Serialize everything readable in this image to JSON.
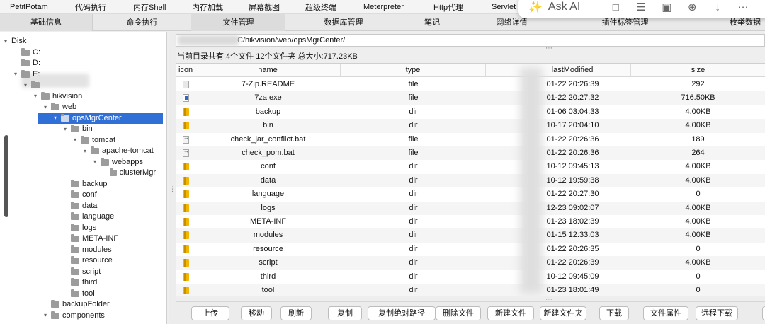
{
  "menu": [
    "PetitPotam",
    "代码执行",
    "内存Shell",
    "内存加载",
    "屏幕截图",
    "超级终端",
    "Meterpreter",
    "Http代理",
    "Servlet"
  ],
  "tabs": [
    "基础信息",
    "命令执行",
    "文件管理",
    "数据库管理",
    "笔记",
    "网络详情",
    "插件标签管理",
    "枚举数据"
  ],
  "active_tab": "文件管理",
  "ask_ai": {
    "label": "Ask AI",
    "icons": [
      "sparkle-icon",
      "chat-icon",
      "list-icon",
      "crop-icon",
      "zoom-in-icon",
      "download-icon",
      "more-icon"
    ]
  },
  "tree": [
    {
      "label": "Disk",
      "level": 0,
      "toggle": "open"
    },
    {
      "label": "C:",
      "level": 1,
      "toggle": "none"
    },
    {
      "label": "D:",
      "level": 1,
      "toggle": "none"
    },
    {
      "label": "E:",
      "level": 1,
      "toggle": "open"
    },
    {
      "label": "",
      "level": 2,
      "toggle": "open"
    },
    {
      "label": "hikvision",
      "level": 3,
      "toggle": "open"
    },
    {
      "label": "web",
      "level": 4,
      "toggle": "open"
    },
    {
      "label": "opsMgrCenter",
      "level": 5,
      "toggle": "open",
      "selected": true
    },
    {
      "label": "bin",
      "level": 6,
      "toggle": "open"
    },
    {
      "label": "tomcat",
      "level": 7,
      "toggle": "open"
    },
    {
      "label": "apache-tomcat",
      "level": 8,
      "toggle": "open"
    },
    {
      "label": "webapps",
      "level": 9,
      "toggle": "open"
    },
    {
      "label": "clusterMgr",
      "level": 10,
      "toggle": "none"
    },
    {
      "label": "backup",
      "level": 6,
      "toggle": "none"
    },
    {
      "label": "conf",
      "level": 6,
      "toggle": "none"
    },
    {
      "label": "data",
      "level": 6,
      "toggle": "none"
    },
    {
      "label": "language",
      "level": 6,
      "toggle": "none"
    },
    {
      "label": "logs",
      "level": 6,
      "toggle": "none"
    },
    {
      "label": "META-INF",
      "level": 6,
      "toggle": "none"
    },
    {
      "label": "modules",
      "level": 6,
      "toggle": "none"
    },
    {
      "label": "resource",
      "level": 6,
      "toggle": "none"
    },
    {
      "label": "script",
      "level": 6,
      "toggle": "none"
    },
    {
      "label": "third",
      "level": 6,
      "toggle": "none"
    },
    {
      "label": "tool",
      "level": 6,
      "toggle": "none"
    },
    {
      "label": "backupFolder",
      "level": 4,
      "toggle": "none"
    },
    {
      "label": "components",
      "level": 4,
      "toggle": "open"
    }
  ],
  "path": "C/hikvision/web/opsMgrCenter/",
  "summary": "当前目录共有:4个文件 12个文件夹 总大小:717.23KB",
  "columns": [
    "icon",
    "name",
    "type",
    "lastModified",
    "size"
  ],
  "files": [
    {
      "icon": "txt",
      "name": "7-Zip.README",
      "type": "file",
      "modified": "01-22 20:26:39",
      "size": "292"
    },
    {
      "icon": "exe",
      "name": "7za.exe",
      "type": "file",
      "modified": "01-22 20:27:32",
      "size": "716.50KB"
    },
    {
      "icon": "dir",
      "name": "backup",
      "type": "dir",
      "modified": "01-06 03:04:33",
      "size": "4.00KB"
    },
    {
      "icon": "dir",
      "name": "bin",
      "type": "dir",
      "modified": "10-17 20:04:10",
      "size": "4.00KB"
    },
    {
      "icon": "bat",
      "name": "check_jar_conflict.bat",
      "type": "file",
      "modified": "01-22 20:26:36",
      "size": "189"
    },
    {
      "icon": "bat",
      "name": "check_pom.bat",
      "type": "file",
      "modified": "01-22 20:26:36",
      "size": "264"
    },
    {
      "icon": "dir",
      "name": "conf",
      "type": "dir",
      "modified": "10-12 09:45:13",
      "size": "4.00KB"
    },
    {
      "icon": "dir",
      "name": "data",
      "type": "dir",
      "modified": "10-12 19:59:38",
      "size": "4.00KB"
    },
    {
      "icon": "dir",
      "name": "language",
      "type": "dir",
      "modified": "01-22 20:27:30",
      "size": "0"
    },
    {
      "icon": "dir",
      "name": "logs",
      "type": "dir",
      "modified": "12-23 09:02:07",
      "size": "4.00KB"
    },
    {
      "icon": "dir",
      "name": "META-INF",
      "type": "dir",
      "modified": "01-23 18:02:39",
      "size": "4.00KB"
    },
    {
      "icon": "dir",
      "name": "modules",
      "type": "dir",
      "modified": "01-15 12:33:03",
      "size": "4.00KB"
    },
    {
      "icon": "dir",
      "name": "resource",
      "type": "dir",
      "modified": "01-22 20:26:35",
      "size": "0"
    },
    {
      "icon": "dir",
      "name": "script",
      "type": "dir",
      "modified": "01-22 20:26:39",
      "size": "4.00KB"
    },
    {
      "icon": "dir",
      "name": "third",
      "type": "dir",
      "modified": "10-12 09:45:09",
      "size": "0"
    },
    {
      "icon": "dir",
      "name": "tool",
      "type": "dir",
      "modified": "01-23 18:01:49",
      "size": "0"
    }
  ],
  "buttons": [
    "上传",
    "移动",
    "刷新",
    "复制",
    "复制绝对路径",
    "删除文件",
    "新建文件",
    "新建文件夹",
    "下载",
    "文件属性",
    "远程下载",
    "执"
  ]
}
